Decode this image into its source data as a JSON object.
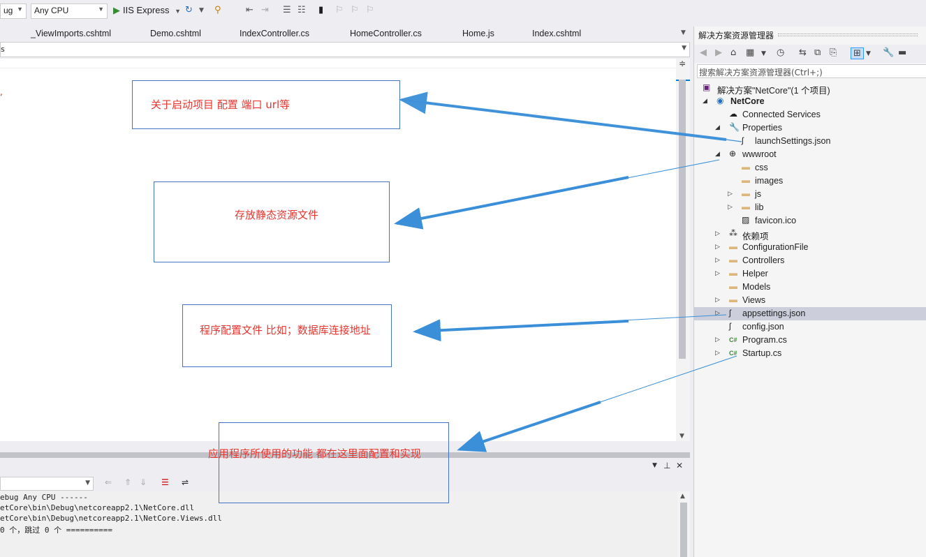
{
  "toolbar": {
    "config_value": "ug",
    "platform_value": "Any CPU",
    "run_label": "IIS Express"
  },
  "tabs": [
    "_ViewImports.cshtml",
    "Demo.cshtml",
    "IndexController.cs",
    "HomeController.cs",
    "Home.js",
    "Index.cshtml"
  ],
  "navbar": {
    "value": "s"
  },
  "annotations": [
    {
      "text": "关于启动项目 配置 端口  url等"
    },
    {
      "text": "存放静态资源文件"
    },
    {
      "text": "程序配置文件  比如；数据库连接地址"
    },
    {
      "text": "应用程序所使用的功能  都在这里面配置和实现"
    }
  ],
  "output": {
    "lines": [
      "ebug Any CPU ------",
      "etCore\\bin\\Debug\\netcoreapp2.1\\NetCore.dll",
      "etCore\\bin\\Debug\\netcoreapp2.1\\NetCore.Views.dll",
      " 0 个，跳过 0 个 =========="
    ]
  },
  "solution_explorer": {
    "title": "解决方案资源管理器",
    "search_placeholder": "搜索解决方案资源管理器(Ctrl+;)",
    "solution": "解决方案\"NetCore\"(1 个项目)",
    "project": "NetCore",
    "items": [
      {
        "label": "Connected Services",
        "icon": "connected-services-icon"
      },
      {
        "label": "Properties",
        "icon": "wrench-icon"
      },
      {
        "label": "launchSettings.json",
        "icon": "json-file-icon"
      },
      {
        "label": "wwwroot",
        "icon": "globe-icon"
      },
      {
        "label": "css",
        "icon": "folder-icon"
      },
      {
        "label": "images",
        "icon": "folder-icon"
      },
      {
        "label": "js",
        "icon": "folder-icon"
      },
      {
        "label": "lib",
        "icon": "folder-icon"
      },
      {
        "label": "favicon.ico",
        "icon": "image-file-icon"
      },
      {
        "label": "依赖项",
        "icon": "dependencies-icon"
      },
      {
        "label": "ConfigurationFile",
        "icon": "folder-icon"
      },
      {
        "label": "Controllers",
        "icon": "folder-icon"
      },
      {
        "label": "Helper",
        "icon": "folder-icon"
      },
      {
        "label": "Models",
        "icon": "folder-icon"
      },
      {
        "label": "Views",
        "icon": "folder-icon"
      },
      {
        "label": "appsettings.json",
        "icon": "json-file-icon",
        "selected": true
      },
      {
        "label": "config.json",
        "icon": "json-file-icon"
      },
      {
        "label": "Program.cs",
        "icon": "csharp-file-icon"
      },
      {
        "label": "Startup.cs",
        "icon": "csharp-file-icon"
      }
    ]
  },
  "colors": {
    "annotation_text": "#e8352f",
    "annotation_border": "#4472c4",
    "arrow": "#3b8fd9",
    "selection": "#cccedb"
  }
}
